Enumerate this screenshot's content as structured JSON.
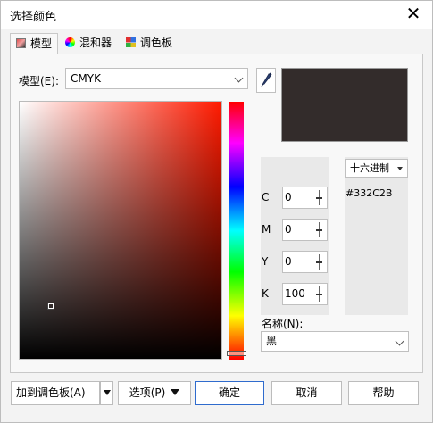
{
  "window": {
    "title": "选择颜色",
    "close_glyph": "✕"
  },
  "tabs": [
    {
      "label": "模型",
      "icon": "model-icon",
      "active": true
    },
    {
      "label": "混和器",
      "icon": "mixer-icon",
      "active": false
    },
    {
      "label": "调色板",
      "icon": "palette-icon",
      "active": false
    }
  ],
  "model": {
    "label": "模型(E):",
    "value": "CMYK"
  },
  "color": {
    "hex_mode": "十六进制",
    "hex_value": "#332C2B",
    "preview_color": "#332C2B"
  },
  "channels": [
    {
      "label": "C",
      "value": "0"
    },
    {
      "label": "M",
      "value": "0"
    },
    {
      "label": "Y",
      "value": "0"
    },
    {
      "label": "K",
      "value": "100"
    }
  ],
  "name": {
    "label": "名称(N):",
    "value": "黑"
  },
  "buttons": {
    "add_palette": "加到调色板(A)",
    "options": "选项(P)",
    "ok": "确定",
    "cancel": "取消",
    "help": "帮助"
  },
  "colors": {
    "accent": "#2f6bcd",
    "hue_top": "#ff0000",
    "field_hue": "#ff1a00"
  },
  "icons": [
    "close-icon",
    "eyedropper-icon",
    "chevron-down-icon",
    "model-icon",
    "mixer-icon",
    "palette-icon"
  ]
}
